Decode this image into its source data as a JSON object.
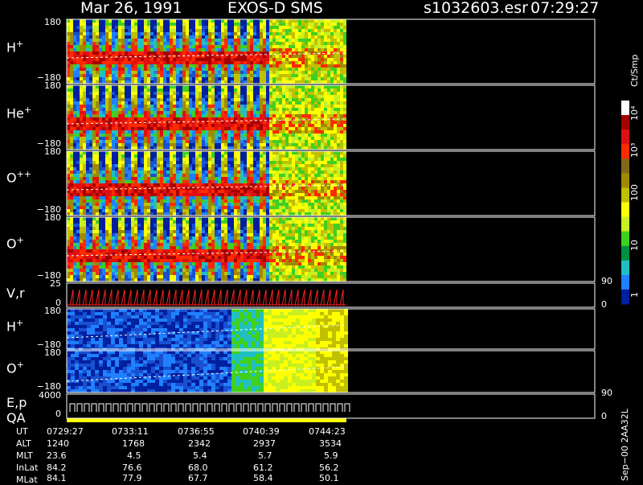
{
  "header": {
    "date": "Mar 26, 1991",
    "mission": "EXOS-D SMS",
    "file": "s1032603.esr",
    "time": "07:29:27"
  },
  "colorbar": {
    "unit": "Ct/Smp",
    "labels": [
      "10⁴",
      "10³",
      "100",
      "10",
      "1"
    ],
    "colors": [
      "#ffffff",
      "#a50000",
      "#e01010",
      "#ff2a00",
      "#806a1a",
      "#a08a00",
      "#c0c000",
      "#ffff00",
      "#c8f020",
      "#40d020",
      "#009040",
      "#20c0c0",
      "#2080ff",
      "#0020a0"
    ]
  },
  "panels": [
    {
      "label": "H",
      "sup": "+",
      "ymax": "180",
      "ymin": "−180"
    },
    {
      "label": "He",
      "sup": "+",
      "ymax": "180",
      "ymin": "−180"
    },
    {
      "label": "O",
      "sup": "++",
      "ymax": "180",
      "ymin": "−180"
    },
    {
      "label": "O",
      "sup": "+",
      "ymax": "180",
      "ymin": "−180"
    },
    {
      "label": "V,r",
      "sup": "",
      "ymax": "25",
      "ymin": "0",
      "rmax": "90",
      "rmin": "0"
    },
    {
      "label": "H",
      "sup": "+",
      "ymax": "180",
      "ymin": "−180"
    },
    {
      "label": "O",
      "sup": "+",
      "ymax": "180",
      "ymin": "−180"
    },
    {
      "label": "E,p",
      "sup": "",
      "ymax": "4000",
      "ymin": "0",
      "rmax": "90",
      "rmin": "0"
    }
  ],
  "qa_label": "QA",
  "ephemeris": {
    "rows": [
      {
        "name": "UT",
        "values": [
          "0729:27",
          "0733:11",
          "0736:55",
          "0740:39",
          "0744:23"
        ]
      },
      {
        "name": "ALT",
        "values": [
          "1240",
          "1768",
          "2342",
          "2937",
          "3534"
        ]
      },
      {
        "name": "MLT",
        "values": [
          "23.6",
          "4.5",
          "5.4",
          "5.7",
          "5.9"
        ]
      },
      {
        "name": "InLat",
        "values": [
          "84.2",
          "76.6",
          "68.0",
          "61.2",
          "56.2"
        ]
      },
      {
        "name": "MLat",
        "values": [
          "84.1",
          "77.9",
          "67.7",
          "58.4",
          "50.1"
        ]
      }
    ]
  },
  "footer_vertical": "Sep−00  2AA32L",
  "chart_data": {
    "type": "heatmap",
    "title": "Mar 26, 1991   EXOS-D SMS",
    "x_ticks": [
      "0729:27",
      "0733:11",
      "0736:55",
      "0740:39",
      "0744:23"
    ],
    "series": [
      {
        "name": "H+",
        "ylim": [
          -180,
          180
        ]
      },
      {
        "name": "He+",
        "ylim": [
          -180,
          180
        ]
      },
      {
        "name": "O++",
        "ylim": [
          -180,
          180
        ]
      },
      {
        "name": "O+",
        "ylim": [
          -180,
          180
        ]
      },
      {
        "name": "V,r",
        "ylim": [
          0,
          25
        ],
        "right_ylim": [
          0,
          90
        ]
      },
      {
        "name": "H+",
        "ylim": [
          -180,
          180
        ]
      },
      {
        "name": "O+",
        "ylim": [
          -180,
          180
        ]
      },
      {
        "name": "E,p",
        "ylim": [
          0,
          4000
        ],
        "right_ylim": [
          0,
          90
        ]
      }
    ],
    "colorbar_range": [
      "1",
      "10⁴"
    ],
    "colorbar_unit": "Ct/Smp"
  }
}
